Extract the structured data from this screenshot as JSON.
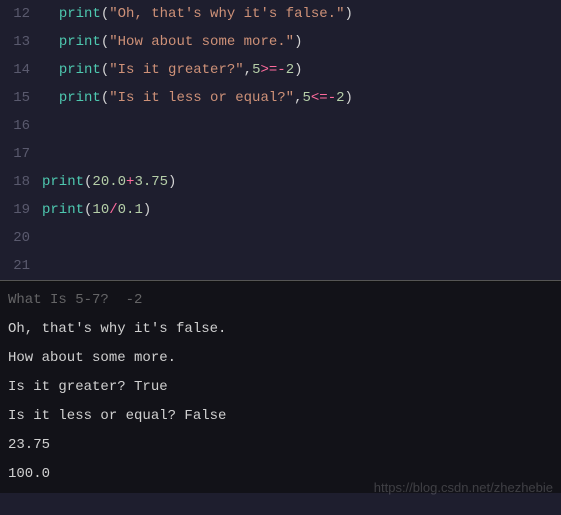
{
  "editor": {
    "lines": [
      {
        "num": "12",
        "tokens": [
          [
            "sp",
            "  "
          ],
          [
            "fn",
            "print"
          ],
          [
            "pn",
            "("
          ],
          [
            "str",
            "\"Oh, that's why it's false.\""
          ],
          [
            "pn",
            ")"
          ]
        ]
      },
      {
        "num": "13",
        "tokens": [
          [
            "sp",
            "  "
          ],
          [
            "fn",
            "print"
          ],
          [
            "pn",
            "("
          ],
          [
            "str",
            "\"How about some more.\""
          ],
          [
            "pn",
            ")"
          ]
        ]
      },
      {
        "num": "14",
        "tokens": [
          [
            "sp",
            "  "
          ],
          [
            "fn",
            "print"
          ],
          [
            "pn",
            "("
          ],
          [
            "str",
            "\"Is it greater?\""
          ],
          [
            "pn",
            ","
          ],
          [
            "num",
            "5"
          ],
          [
            "op",
            ">="
          ],
          [
            "op",
            "-"
          ],
          [
            "num",
            "2"
          ],
          [
            "pn",
            ")"
          ]
        ]
      },
      {
        "num": "15",
        "tokens": [
          [
            "sp",
            "  "
          ],
          [
            "fn",
            "print"
          ],
          [
            "pn",
            "("
          ],
          [
            "str",
            "\"Is it less or equal?\""
          ],
          [
            "pn",
            ","
          ],
          [
            "num",
            "5"
          ],
          [
            "op",
            "<="
          ],
          [
            "op",
            "-"
          ],
          [
            "num",
            "2"
          ],
          [
            "pn",
            ")"
          ]
        ]
      },
      {
        "num": "16",
        "tokens": []
      },
      {
        "num": "17",
        "tokens": []
      },
      {
        "num": "18",
        "tokens": [
          [
            "fn",
            "print"
          ],
          [
            "pn",
            "("
          ],
          [
            "num",
            "20.0"
          ],
          [
            "op",
            "+"
          ],
          [
            "num",
            "3.75"
          ],
          [
            "pn",
            ")"
          ]
        ]
      },
      {
        "num": "19",
        "tokens": [
          [
            "fn",
            "print"
          ],
          [
            "pn",
            "("
          ],
          [
            "num",
            "10"
          ],
          [
            "op",
            "/"
          ],
          [
            "num",
            "0.1"
          ],
          [
            "pn",
            ")"
          ]
        ]
      },
      {
        "num": "20",
        "tokens": []
      },
      {
        "num": "21",
        "tokens": []
      }
    ]
  },
  "terminal": {
    "lines": [
      "What Is 5-7?  -2",
      "Oh, that's why it's false.",
      "How about some more.",
      "Is it greater? True",
      "Is it less or equal? False",
      "23.75",
      "100.0"
    ]
  },
  "watermark": "https://blog.csdn.net/zhezhebie"
}
